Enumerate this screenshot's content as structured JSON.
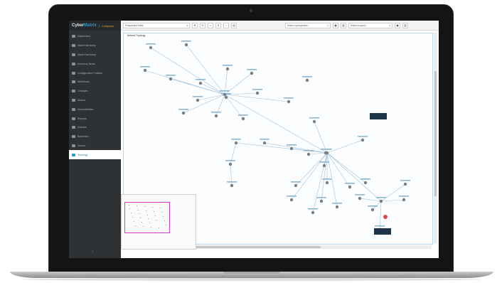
{
  "brand": {
    "name_part1": "Cyber",
    "name_part2": "Matrix",
    "tab_label": "Company"
  },
  "sidebar": {
    "items": [
      {
        "label": "Dashboard",
        "icon": "dashboard-icon"
      },
      {
        "label": "Asset Hierarchy",
        "icon": "hierarchy-icon"
      },
      {
        "label": "Asset Discovery",
        "icon": "monitor-icon"
      },
      {
        "label": "Inventory Items",
        "icon": "inventory-icon"
      },
      {
        "label": "Configuration Policies",
        "icon": "policy-icon"
      },
      {
        "label": "Workflows",
        "icon": "workflow-icon"
      },
      {
        "label": "Changes",
        "icon": "changes-icon"
      },
      {
        "label": "Alarms",
        "icon": "alarm-icon"
      },
      {
        "label": "Vulnerabilities",
        "icon": "vulnerability-icon"
      },
      {
        "label": "Reports",
        "icon": "report-icon"
      },
      {
        "label": "Queries",
        "icon": "search-icon"
      },
      {
        "label": "Baselines",
        "icon": "baseline-icon"
      },
      {
        "label": "Search",
        "icon": "eye-icon"
      },
      {
        "label": "Topology",
        "icon": "topology-icon"
      }
    ],
    "active_index": 13,
    "collapse_glyph": "«"
  },
  "toolbar": {
    "editor_select": "Perspective Editor",
    "perspective_placeholder": "Select a perspective...",
    "layout_placeholder": "Select a layout...",
    "buttons": [
      "▼",
      "↻",
      "🔍",
      "✕",
      "🔍",
      "🗎"
    ]
  },
  "canvas": {
    "title": "Network Topology"
  },
  "accent": "#19a0d8",
  "minimap_color": "#d23fc8"
}
